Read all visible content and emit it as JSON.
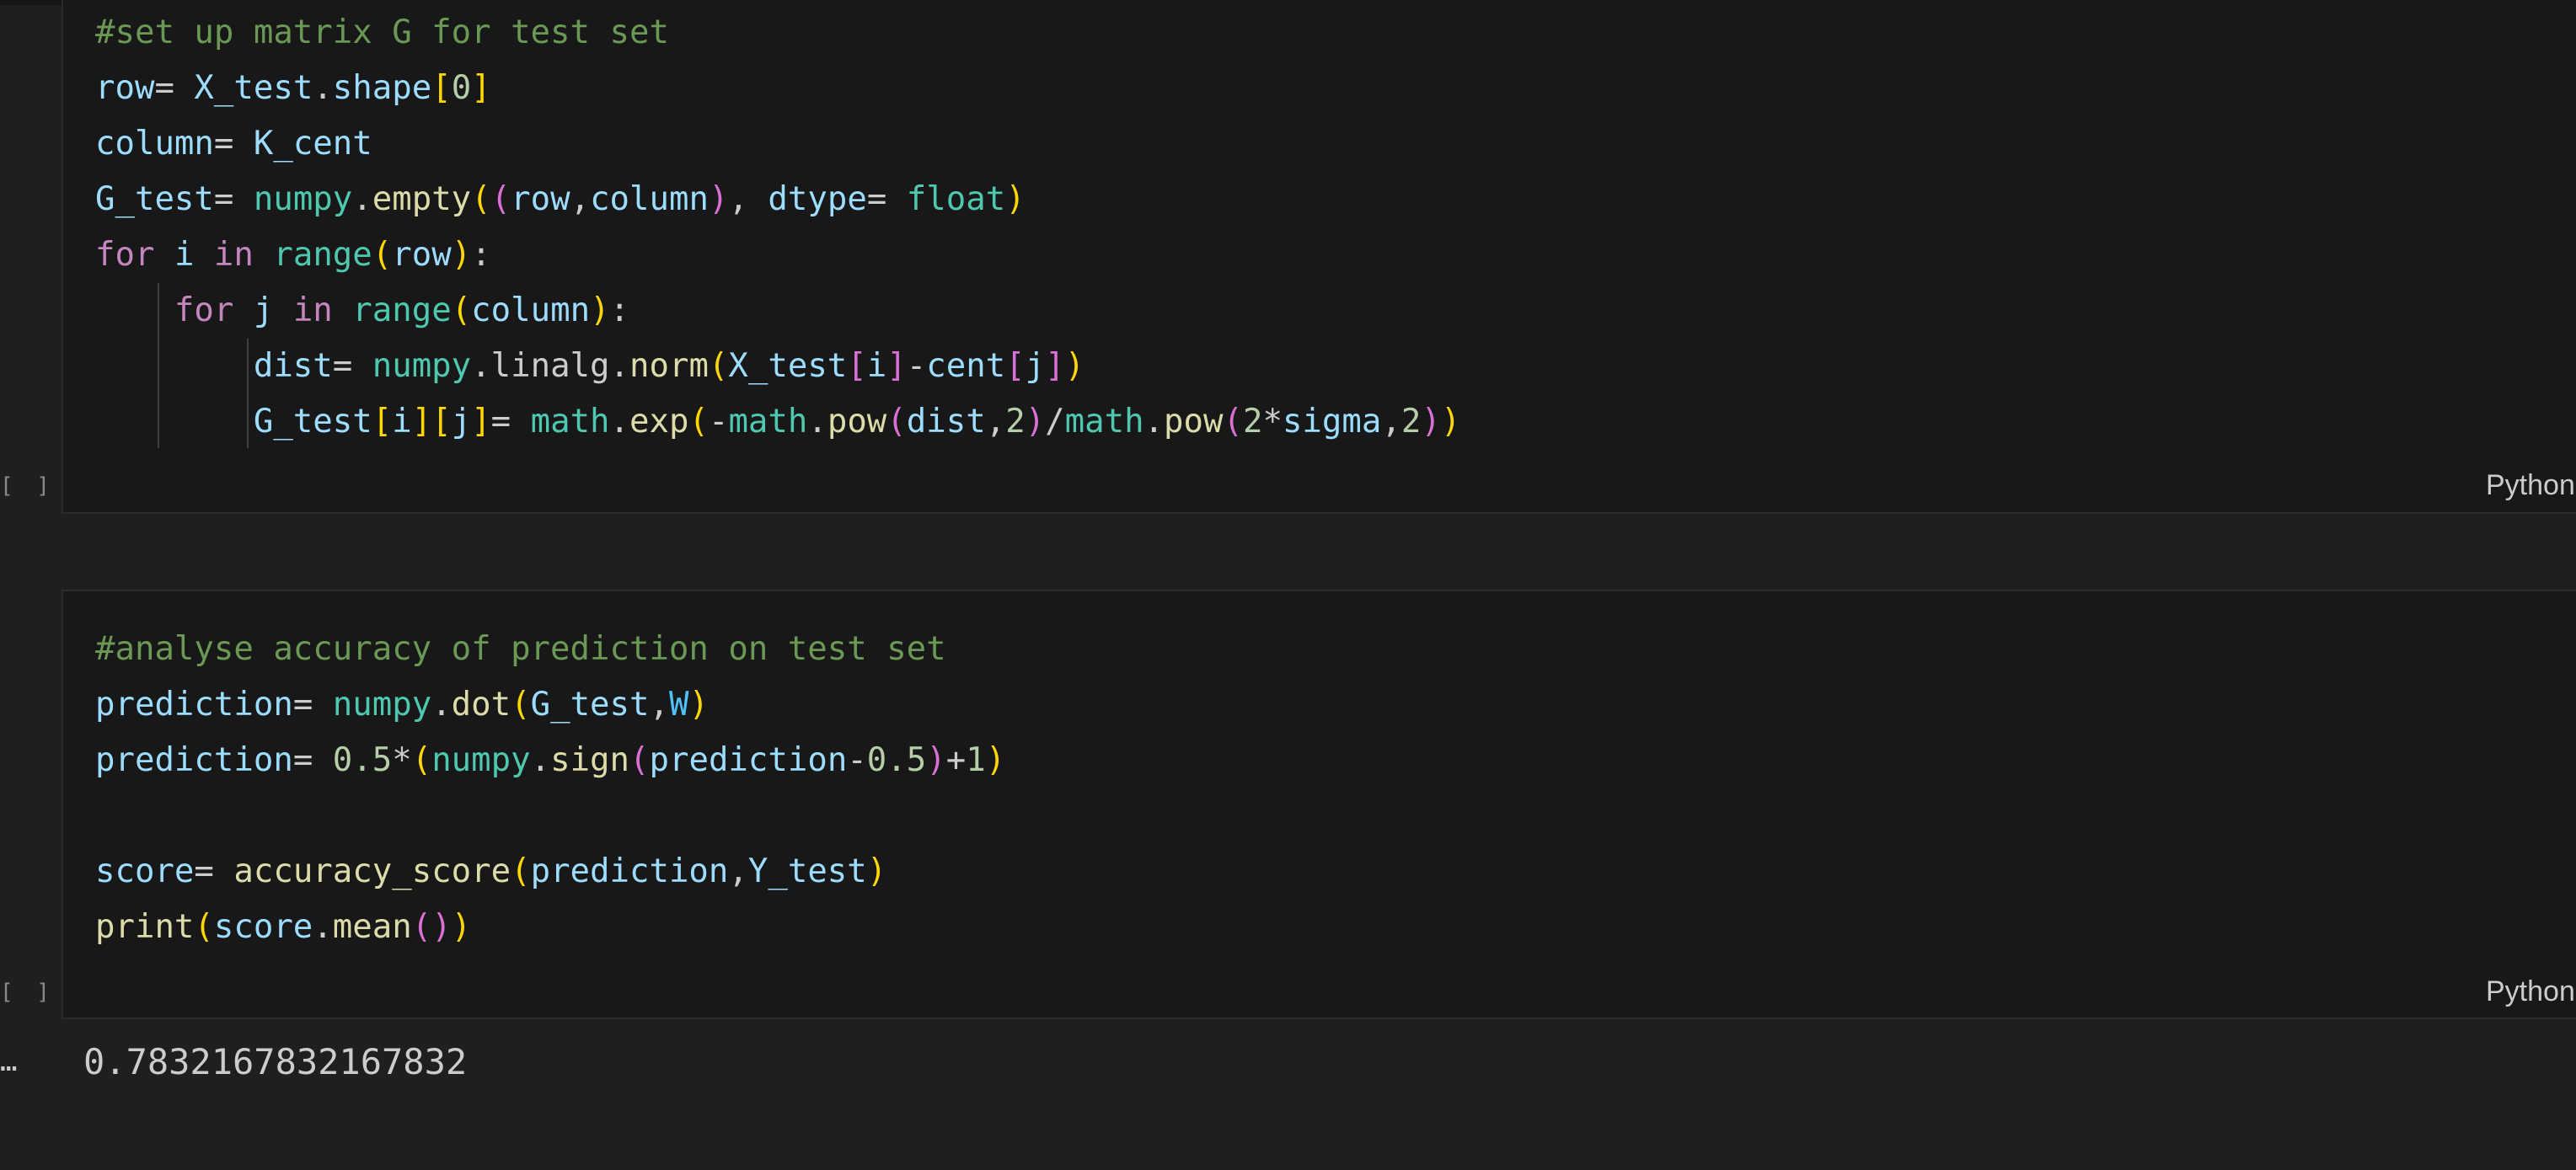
{
  "cells": [
    {
      "language": "Python",
      "execution_count": "[ ]",
      "lines": [
        [
          [
            "#set up matrix G for test set",
            "c"
          ]
        ],
        [
          [
            "row",
            "v"
          ],
          [
            "= ",
            "o"
          ],
          [
            "X_test",
            "v"
          ],
          [
            ".",
            "o"
          ],
          [
            "shape",
            "v"
          ],
          [
            "[",
            "b1"
          ],
          [
            "0",
            "n"
          ],
          [
            "]",
            "b1"
          ]
        ],
        [
          [
            "column",
            "v"
          ],
          [
            "= ",
            "o"
          ],
          [
            "K_cent",
            "v"
          ]
        ],
        [
          [
            "G_test",
            "v"
          ],
          [
            "= ",
            "o"
          ],
          [
            "numpy",
            "t"
          ],
          [
            ".",
            "o"
          ],
          [
            "empty",
            "f"
          ],
          [
            "(",
            "b1"
          ],
          [
            "(",
            "b2"
          ],
          [
            "row",
            "v"
          ],
          [
            ",",
            "o"
          ],
          [
            "column",
            "v"
          ],
          [
            ")",
            "b2"
          ],
          [
            ", ",
            "o"
          ],
          [
            "dtype",
            "v"
          ],
          [
            "= ",
            "o"
          ],
          [
            "float",
            "t"
          ],
          [
            ")",
            "b1"
          ]
        ],
        [
          [
            "for",
            "k"
          ],
          [
            " ",
            "o"
          ],
          [
            "i",
            "v"
          ],
          [
            " ",
            "o"
          ],
          [
            "in",
            "k"
          ],
          [
            " ",
            "o"
          ],
          [
            "range",
            "t"
          ],
          [
            "(",
            "b1"
          ],
          [
            "row",
            "v"
          ],
          [
            ")",
            "b1"
          ],
          [
            ":",
            "o"
          ]
        ],
        [
          [
            "    ",
            "o"
          ],
          [
            "for",
            "k"
          ],
          [
            " ",
            "o"
          ],
          [
            "j",
            "v"
          ],
          [
            " ",
            "o"
          ],
          [
            "in",
            "k"
          ],
          [
            " ",
            "o"
          ],
          [
            "range",
            "t"
          ],
          [
            "(",
            "b1"
          ],
          [
            "column",
            "v"
          ],
          [
            ")",
            "b1"
          ],
          [
            ":",
            "o"
          ]
        ],
        [
          [
            "        ",
            "o"
          ],
          [
            "dist",
            "v"
          ],
          [
            "= ",
            "o"
          ],
          [
            "numpy",
            "t"
          ],
          [
            ".",
            "o"
          ],
          [
            "linalg",
            "o"
          ],
          [
            ".",
            "o"
          ],
          [
            "norm",
            "f"
          ],
          [
            "(",
            "b1"
          ],
          [
            "X_test",
            "v"
          ],
          [
            "[",
            "b2"
          ],
          [
            "i",
            "v"
          ],
          [
            "]",
            "b2"
          ],
          [
            "-",
            "o"
          ],
          [
            "cent",
            "v"
          ],
          [
            "[",
            "b2"
          ],
          [
            "j",
            "v"
          ],
          [
            "]",
            "b2"
          ],
          [
            ")",
            "b1"
          ]
        ],
        [
          [
            "        ",
            "o"
          ],
          [
            "G_test",
            "v"
          ],
          [
            "[",
            "b1"
          ],
          [
            "i",
            "v"
          ],
          [
            "]",
            "b1"
          ],
          [
            "[",
            "b1"
          ],
          [
            "j",
            "v"
          ],
          [
            "]",
            "b1"
          ],
          [
            "= ",
            "o"
          ],
          [
            "math",
            "t"
          ],
          [
            ".",
            "o"
          ],
          [
            "exp",
            "f"
          ],
          [
            "(",
            "b1"
          ],
          [
            "-",
            "o"
          ],
          [
            "math",
            "t"
          ],
          [
            ".",
            "o"
          ],
          [
            "pow",
            "f"
          ],
          [
            "(",
            "b2"
          ],
          [
            "dist",
            "v"
          ],
          [
            ",",
            "o"
          ],
          [
            "2",
            "n"
          ],
          [
            ")",
            "b2"
          ],
          [
            "/",
            "o"
          ],
          [
            "math",
            "t"
          ],
          [
            ".",
            "o"
          ],
          [
            "pow",
            "f"
          ],
          [
            "(",
            "b2"
          ],
          [
            "2",
            "n"
          ],
          [
            "*",
            "o"
          ],
          [
            "sigma",
            "v"
          ],
          [
            ",",
            "o"
          ],
          [
            "2",
            "n"
          ],
          [
            ")",
            "b2"
          ],
          [
            ")",
            "b1"
          ]
        ]
      ]
    },
    {
      "language": "Python",
      "execution_count": "[ ]",
      "lines": [
        [
          [
            "#analyse accuracy of prediction on test set",
            "c"
          ]
        ],
        [
          [
            "prediction",
            "v"
          ],
          [
            "= ",
            "o"
          ],
          [
            "numpy",
            "t"
          ],
          [
            ".",
            "o"
          ],
          [
            "dot",
            "f"
          ],
          [
            "(",
            "b1"
          ],
          [
            "G_test",
            "v"
          ],
          [
            ",",
            "o"
          ],
          [
            "W",
            "cst"
          ],
          [
            ")",
            "b1"
          ]
        ],
        [
          [
            "prediction",
            "v"
          ],
          [
            "= ",
            "o"
          ],
          [
            "0.5",
            "n"
          ],
          [
            "*",
            "o"
          ],
          [
            "(",
            "b1"
          ],
          [
            "numpy",
            "t"
          ],
          [
            ".",
            "o"
          ],
          [
            "sign",
            "f"
          ],
          [
            "(",
            "b2"
          ],
          [
            "prediction",
            "v"
          ],
          [
            "-",
            "o"
          ],
          [
            "0.5",
            "n"
          ],
          [
            ")",
            "b2"
          ],
          [
            "+",
            "o"
          ],
          [
            "1",
            "n"
          ],
          [
            ")",
            "b1"
          ]
        ],
        [],
        [
          [
            "score",
            "v"
          ],
          [
            "= ",
            "o"
          ],
          [
            "accuracy_score",
            "f"
          ],
          [
            "(",
            "b1"
          ],
          [
            "prediction",
            "v"
          ],
          [
            ",",
            "o"
          ],
          [
            "Y_test",
            "v"
          ],
          [
            ")",
            "b1"
          ]
        ],
        [
          [
            "print",
            "f"
          ],
          [
            "(",
            "b1"
          ],
          [
            "score",
            "v"
          ],
          [
            ".",
            "o"
          ],
          [
            "mean",
            "f"
          ],
          [
            "(",
            "b2"
          ],
          [
            ")",
            "b2"
          ],
          [
            ")",
            "b1"
          ]
        ]
      ],
      "output_prompt": "…",
      "output": "0.7832167832167832"
    }
  ]
}
